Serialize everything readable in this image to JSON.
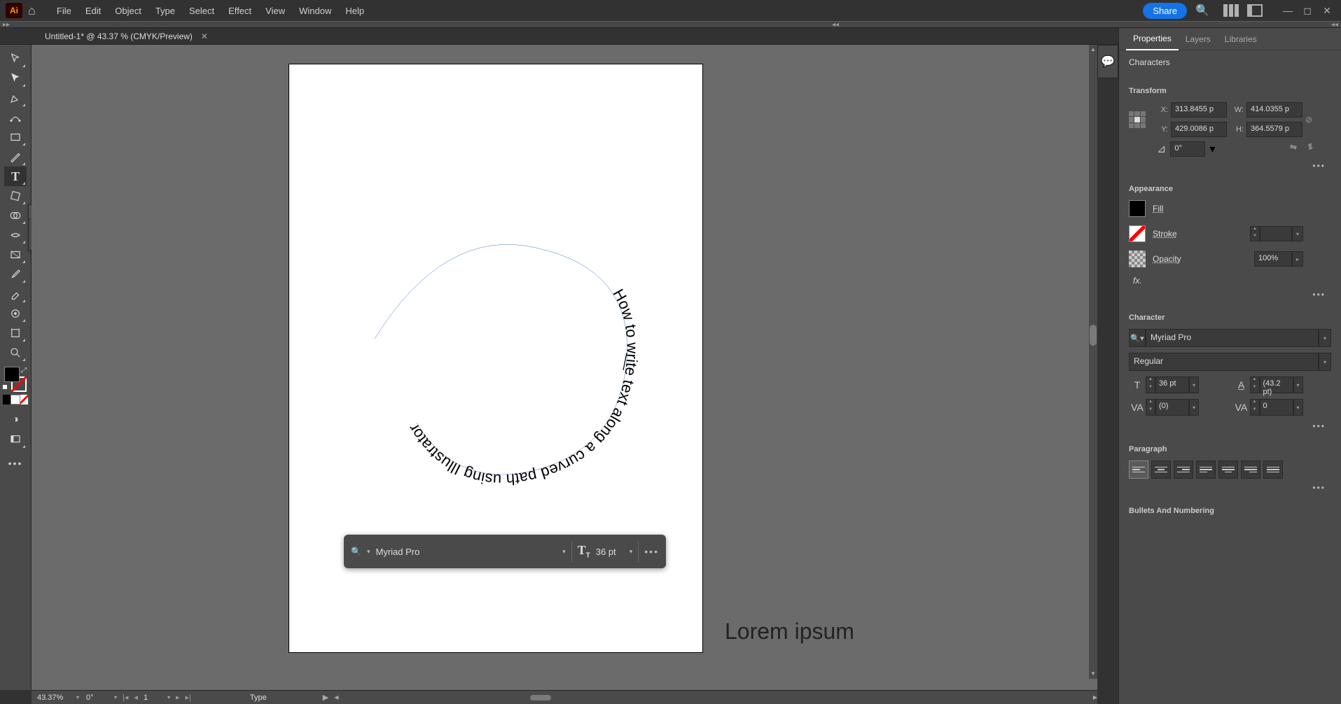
{
  "app": {
    "logo_text": "Ai",
    "menus": [
      "File",
      "Edit",
      "Object",
      "Type",
      "Select",
      "Effect",
      "View",
      "Window",
      "Help"
    ],
    "share_label": "Share"
  },
  "document": {
    "tab_title": "Untitled-1* @ 43.37 % (CMYK/Preview)"
  },
  "canvas": {
    "path_text": "How to write text along a curved path using Illustrator",
    "lorem_text": "Lorem ipsum"
  },
  "float_toolbar": {
    "font": "Myriad Pro",
    "size": "36 pt"
  },
  "statusbar": {
    "zoom": "43.37%",
    "rotation": "0°",
    "artboard": "1",
    "tool": "Type"
  },
  "panel": {
    "tabs": [
      "Properties",
      "Layers",
      "Libraries"
    ],
    "selection_type": "Characters",
    "transform": {
      "title": "Transform",
      "x": "313.8455 p",
      "y": "429.0086 p",
      "w": "414.0355 p",
      "h": "364.5579 p",
      "angle": "0°"
    },
    "appearance": {
      "title": "Appearance",
      "fill_label": "Fill",
      "stroke_label": "Stroke",
      "opacity_label": "Opacity",
      "opacity_value": "100%",
      "fx_label": "fx."
    },
    "character": {
      "title": "Character",
      "font": "Myriad Pro",
      "style": "Regular",
      "size": "36 pt",
      "leading": "(43.2 pt)",
      "kerning": "(0)",
      "tracking": "0"
    },
    "paragraph": {
      "title": "Paragraph"
    },
    "bullets": {
      "title": "Bullets And Numbering"
    }
  }
}
